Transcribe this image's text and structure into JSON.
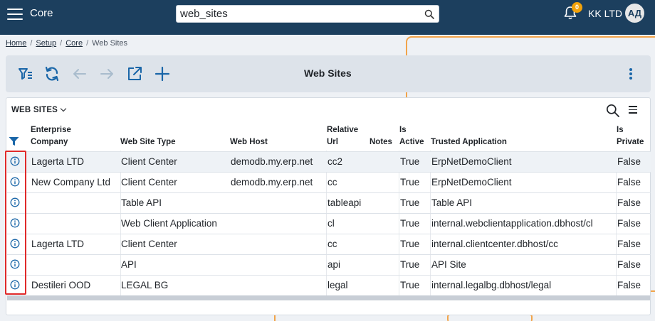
{
  "app": {
    "name": "Core"
  },
  "search": {
    "value": "web_sites"
  },
  "header": {
    "notifications_count": "0",
    "company": "KK LTD",
    "avatar_initials": "АД"
  },
  "breadcrumb": {
    "items": [
      "Home",
      "Setup",
      "Core"
    ],
    "current": "Web Sites"
  },
  "toolbar": {
    "title": "Web Sites"
  },
  "panel": {
    "title": "WEB SITES"
  },
  "columns": [
    {
      "l1": "Enterprise",
      "l2": "Company"
    },
    {
      "l1": "",
      "l2": "Web Site Type"
    },
    {
      "l1": "",
      "l2": "Web Host"
    },
    {
      "l1": "Relative",
      "l2": "Url"
    },
    {
      "l1": "",
      "l2": "Notes"
    },
    {
      "l1": "Is",
      "l2": "Active"
    },
    {
      "l1": "",
      "l2": "Trusted Application"
    },
    {
      "l1": "Is",
      "l2": "Private"
    }
  ],
  "rows": [
    [
      "Lagerta LTD",
      "Client Center",
      "demodb.my.erp.net",
      "cc2",
      "",
      "True",
      "ErpNetDemoClient",
      "False"
    ],
    [
      "New Company Ltd",
      "Client Center",
      "demodb.my.erp.net",
      "cc",
      "",
      "True",
      "ErpNetDemoClient",
      "False"
    ],
    [
      "",
      "Table API",
      "",
      "tableapi",
      "",
      "True",
      "Table API",
      "False"
    ],
    [
      "",
      "Web Client Application",
      "",
      "cl",
      "",
      "True",
      "internal.webclientapplication.dbhost/cl",
      "False"
    ],
    [
      "Lagerta LTD",
      "Client Center",
      "",
      "cc",
      "",
      "True",
      "internal.clientcenter.dbhost/cc",
      "False"
    ],
    [
      "",
      "API",
      "",
      "api",
      "",
      "True",
      "API Site",
      "False"
    ],
    [
      "Destileri OOD",
      "LEGAL BG",
      "",
      "legal",
      "",
      "True",
      "internal.legalbg.dbhost/legal",
      "False"
    ]
  ],
  "colors": {
    "topbar": "#1c3f5e",
    "accent": "#1a66a8",
    "highlight": "#e02a2a",
    "badge": "#f2a20a"
  }
}
